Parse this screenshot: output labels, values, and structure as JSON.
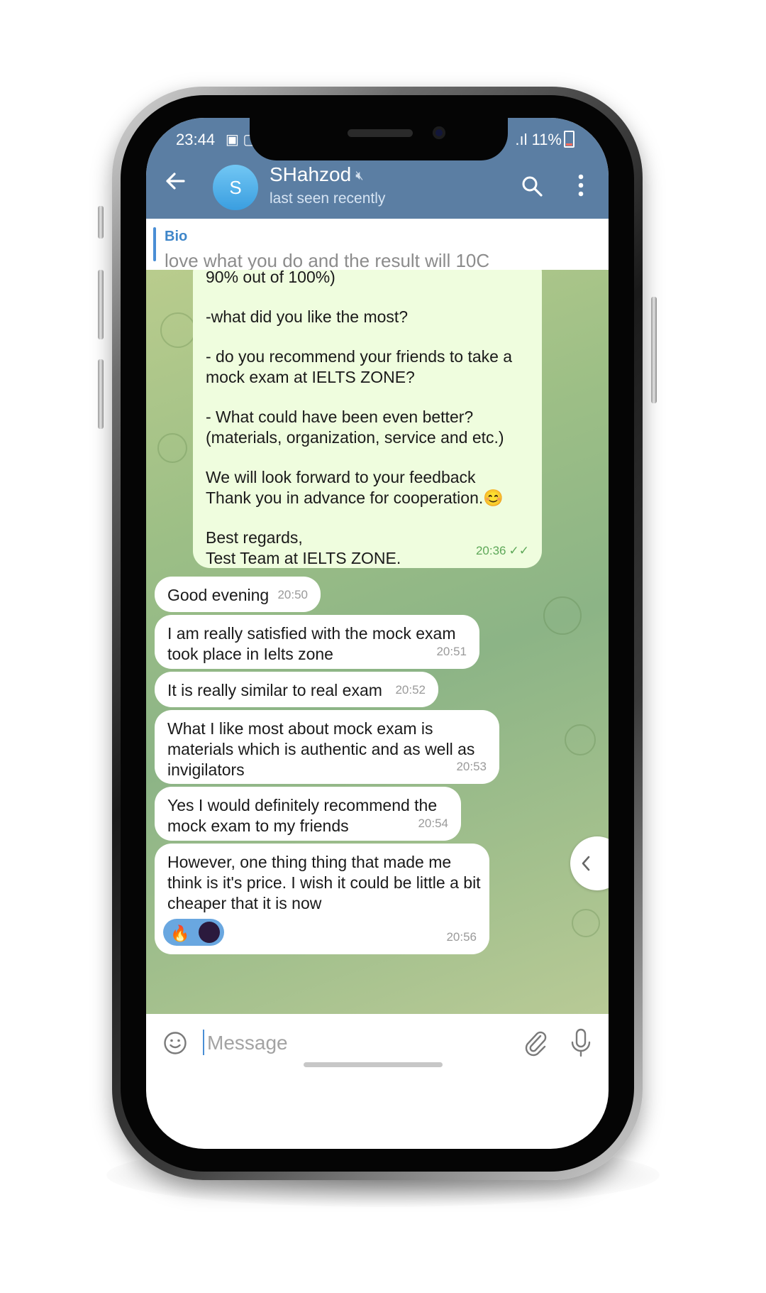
{
  "status_bar": {
    "time": "23:44",
    "battery": "11%"
  },
  "header": {
    "avatar_letter": "S",
    "contact_name": "SHahzod",
    "contact_status": "last seen recently",
    "back_icon": "arrow-left-icon",
    "search_icon": "search-icon",
    "more_icon": "more-vertical-icon",
    "mute_icon": "muted-icon"
  },
  "bio": {
    "label": "Bio",
    "text": "love what you do and the result will 10C"
  },
  "messages": [
    {
      "direction": "outgoing",
      "lines": [
        "90% out of 100%)",
        "",
        "-what did you like the most?",
        "",
        "- do you recommend your friends to take a",
        "mock exam at IELTS ZONE?",
        "",
        "- What could have been even better?",
        "(materials, organization, service and etc.)",
        "",
        "We will look forward to your feedback",
        "Thank you in advance for cooperation.😊",
        "",
        "Best regards,",
        "Test Team at IELTS ZONE."
      ],
      "time": "20:36",
      "status": "read"
    },
    {
      "direction": "incoming",
      "text": "Good evening",
      "time": "20:50"
    },
    {
      "direction": "incoming",
      "text": "I am really satisfied with the mock exam took place in Ielts zone",
      "time": "20:51"
    },
    {
      "direction": "incoming",
      "text": "It is really similar to real exam",
      "time": "20:52"
    },
    {
      "direction": "incoming",
      "text": "What I like most about mock exam is materials which is authentic and as well as invigilators",
      "time": "20:53"
    },
    {
      "direction": "incoming",
      "text": "Yes I would definitely recommend the mock exam to my friends",
      "time": "20:54"
    },
    {
      "direction": "incoming",
      "text": "However, one thing thing that made me think is it's price.  I wish it could be little a bit cheaper that it is now",
      "time": "20:56",
      "reactions": [
        "🔥"
      ]
    }
  ],
  "composer": {
    "placeholder": "Message",
    "emoji_icon": "smiley-icon",
    "attach_icon": "paperclip-icon",
    "mic_icon": "microphone-icon"
  }
}
